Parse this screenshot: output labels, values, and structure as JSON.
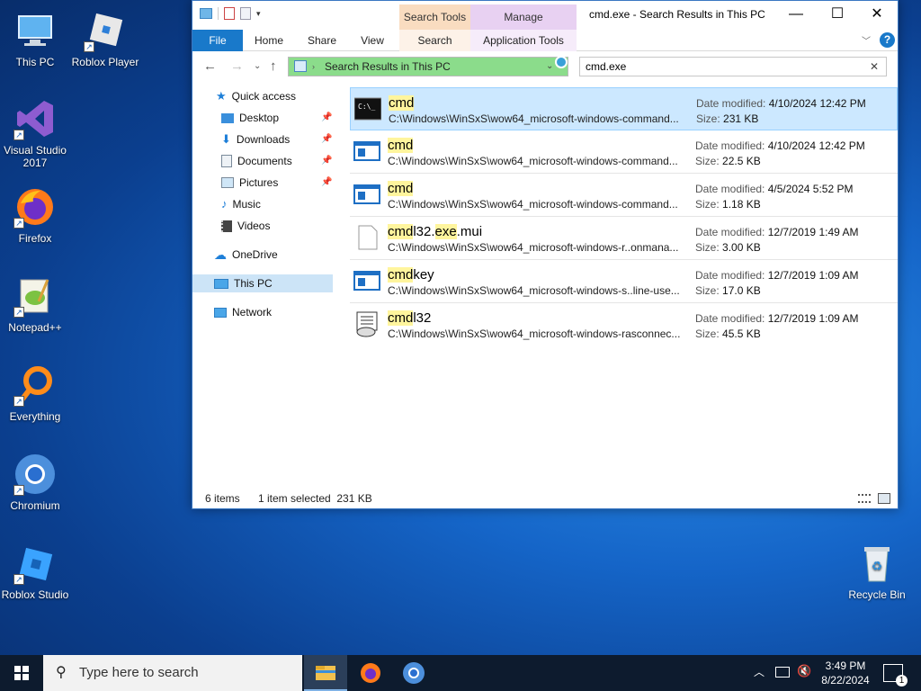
{
  "desktop": {
    "icons": [
      {
        "label": "This PC"
      },
      {
        "label": "Roblox Player"
      },
      {
        "label": "Visual Studio 2017"
      },
      {
        "label": "Firefox"
      },
      {
        "label": "Notepad++"
      },
      {
        "label": "Everything"
      },
      {
        "label": "Chromium"
      },
      {
        "label": "Roblox Studio"
      },
      {
        "label": "Recycle Bin"
      }
    ]
  },
  "window": {
    "title": "cmd.exe - Search Results in This PC",
    "context_tabs": {
      "search_tools": "Search Tools",
      "manage": "Manage"
    },
    "ribbon_tabs": [
      "File",
      "Home",
      "Share",
      "View",
      "Search",
      "Application Tools"
    ],
    "address": "Search Results in This PC",
    "search_value": "cmd.exe"
  },
  "nav": {
    "quick_access": "Quick access",
    "items": [
      "Desktop",
      "Downloads",
      "Documents",
      "Pictures",
      "Music",
      "Videos"
    ],
    "onedrive": "OneDrive",
    "this_pc": "This PC",
    "network": "Network"
  },
  "results": [
    {
      "name_hl": "cmd",
      "name_rest": "",
      "path": "C:\\Windows\\WinSxS\\wow64_microsoft-windows-command...",
      "mod_label": "Date modified:",
      "mod": "4/10/2024 12:42 PM",
      "size_label": "Size:",
      "size": "231 KB"
    },
    {
      "name_hl": "cmd",
      "name_rest": "",
      "path": "C:\\Windows\\WinSxS\\wow64_microsoft-windows-command...",
      "mod_label": "Date modified:",
      "mod": "4/10/2024 12:42 PM",
      "size_label": "Size:",
      "size": "22.5 KB"
    },
    {
      "name_hl": "cmd",
      "name_rest": "",
      "path": "C:\\Windows\\WinSxS\\wow64_microsoft-windows-command...",
      "mod_label": "Date modified:",
      "mod": "4/5/2024 5:52 PM",
      "size_label": "Size:",
      "size": "1.18 KB"
    },
    {
      "name_hl": "cmd",
      "name_mid": "l32.",
      "name_hl2": "exe",
      "name_rest": ".mui",
      "path": "C:\\Windows\\WinSxS\\wow64_microsoft-windows-r..onmana...",
      "mod_label": "Date modified:",
      "mod": "12/7/2019 1:49 AM",
      "size_label": "Size:",
      "size": "3.00 KB"
    },
    {
      "name_hl": "cmd",
      "name_rest": "key",
      "path": "C:\\Windows\\WinSxS\\wow64_microsoft-windows-s..line-use...",
      "mod_label": "Date modified:",
      "mod": "12/7/2019 1:09 AM",
      "size_label": "Size:",
      "size": "17.0 KB"
    },
    {
      "name_hl": "cmd",
      "name_rest": "l32",
      "path": "C:\\Windows\\WinSxS\\wow64_microsoft-windows-rasconnec...",
      "mod_label": "Date modified:",
      "mod": "12/7/2019 1:09 AM",
      "size_label": "Size:",
      "size": "45.5 KB"
    }
  ],
  "status": {
    "count": "6 items",
    "selected": "1 item selected  231 KB"
  },
  "taskbar": {
    "search_placeholder": "Type here to search",
    "time": "3:49 PM",
    "date": "8/22/2024",
    "notifications": "1"
  },
  "colors": {
    "accent": "#1979ca",
    "selection": "#cce8ff",
    "highlight": "#fff59d",
    "address_bg": "#8bdc8b"
  }
}
